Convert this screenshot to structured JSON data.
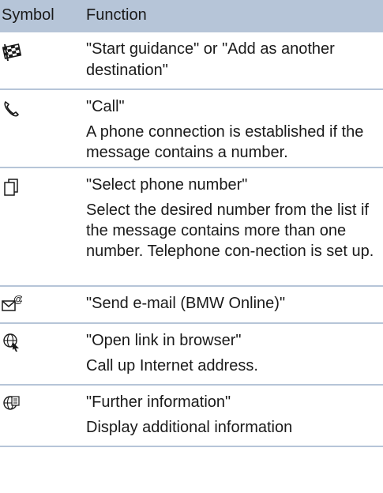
{
  "header": {
    "symbol": "Symbol",
    "function": "Function"
  },
  "rows": [
    {
      "icon": "checkered-flag-icon",
      "title": "\"Start guidance\" or \"Add as another destination\"",
      "desc": ""
    },
    {
      "icon": "phone-handset-icon",
      "title": "\"Call\"",
      "desc": "A phone connection is established if the message contains a number."
    },
    {
      "icon": "select-number-icon",
      "title": "\"Select phone number\"",
      "desc": "Select the desired number from the list if the message contains more than one number. Telephone con-nection is set up."
    },
    {
      "icon": "email-at-icon",
      "title": "\"Send e-mail (BMW Online)\"",
      "desc": ""
    },
    {
      "icon": "globe-cursor-icon",
      "title": "\"Open link in browser\"",
      "desc": "Call up Internet address."
    },
    {
      "icon": "globe-info-icon",
      "title": "\"Further information\"",
      "desc": "Display additional information"
    }
  ]
}
